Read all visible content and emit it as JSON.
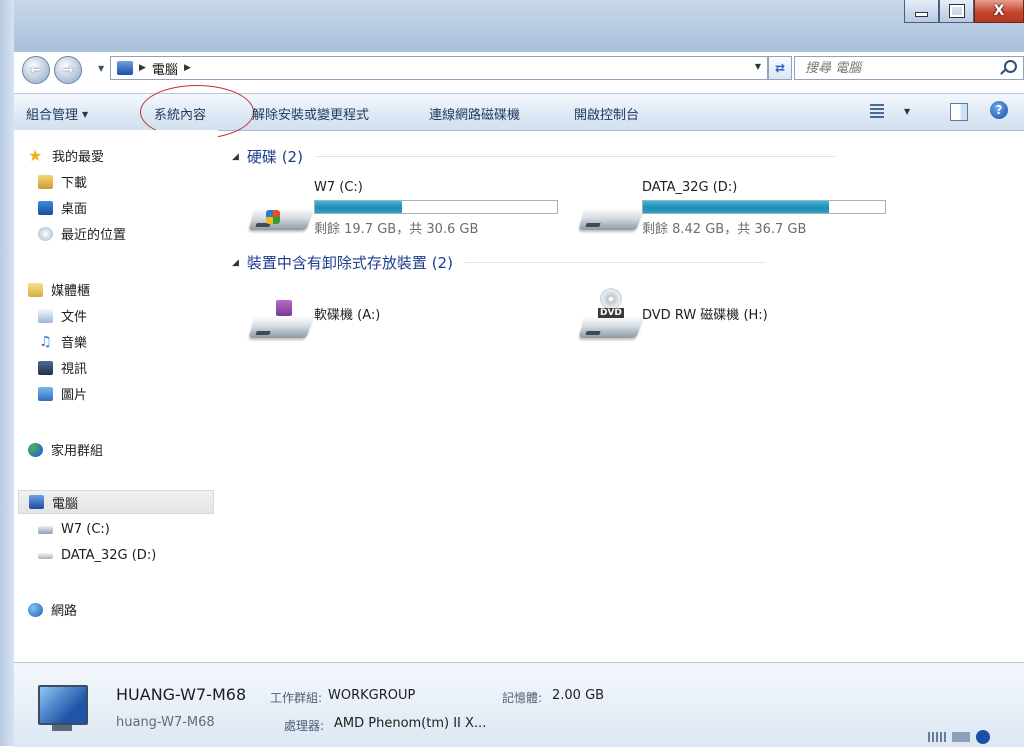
{
  "window": {
    "minimize_icon": "minimize-icon",
    "maximize_icon": "maximize-icon",
    "close_icon": "close-icon",
    "close_label": "X"
  },
  "navigation": {
    "back_icon": "back-arrow-icon",
    "forward_icon": "forward-arrow-icon",
    "breadcrumb": [
      "電腦"
    ],
    "search_placeholder": "搜尋 電腦"
  },
  "toolbar": {
    "organize": "組合管理",
    "system_properties": "系統內容",
    "uninstall": "解除安裝或變更程式",
    "map_drive": "連線網路磁碟機",
    "control_panel": "開啟控制台"
  },
  "sidebar": {
    "favorites": {
      "title": "我的最愛",
      "items": [
        "下載",
        "桌面",
        "最近的位置"
      ]
    },
    "libraries": {
      "title": "媒體櫃",
      "items": [
        "文件",
        "音樂",
        "視訊",
        "圖片"
      ]
    },
    "homegroup": "家用群組",
    "computer": {
      "title": "電腦",
      "items": [
        "W7 (C:)",
        "DATA_32G (D:)"
      ]
    },
    "network": "網路"
  },
  "content": {
    "groups": [
      {
        "header": "硬碟 (2)",
        "drives": [
          {
            "name": "W7 (C:)",
            "free": "剩餘 19.7 GB，共 30.6 GB",
            "used_fraction": 0.36
          },
          {
            "name": "DATA_32G (D:)",
            "free": "剩餘 8.42 GB，共 36.7 GB",
            "used_fraction": 0.77
          }
        ]
      },
      {
        "header": "裝置中含有卸除式存放裝置 (2)",
        "drives": [
          {
            "name": "軟碟機 (A:)"
          },
          {
            "name": "DVD RW 磁碟機 (H:)",
            "badge": "DVD"
          }
        ]
      }
    ]
  },
  "details": {
    "computer_name": "HUANG-W7-M68",
    "workgroup_label": "工作群組:",
    "workgroup": "WORKGROUP",
    "memory_label": "記憶體:",
    "memory": "2.00 GB",
    "user_name": "huang-W7-M68",
    "processor_label": "處理器:",
    "processor": "AMD Phenom(tm) II X..."
  },
  "colors": {
    "accent": "#1e3c8c",
    "bar_fill": "#2a9fc5",
    "highlight_ring": "#c0303a"
  }
}
